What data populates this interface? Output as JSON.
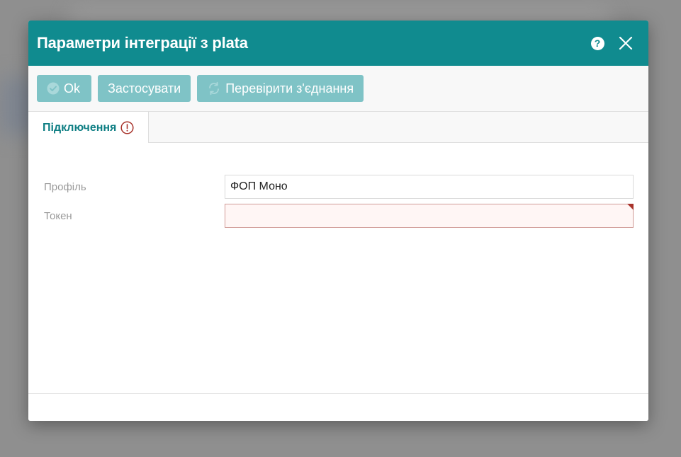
{
  "dialog": {
    "title": "Параметри інтеграції з plata",
    "help_icon": "help-circle-icon",
    "close_icon": "close-icon"
  },
  "toolbar": {
    "ok_label": "Ok",
    "apply_label": "Застосувати",
    "check_connection_label": "Перевірити з'єднання"
  },
  "tabs": [
    {
      "label": "Підключення",
      "active": true,
      "has_error": true
    }
  ],
  "form": {
    "profile": {
      "label": "Профіль",
      "value": "ФОП Моно"
    },
    "token": {
      "label": "Токен",
      "value": "",
      "invalid": true
    }
  },
  "colors": {
    "header": "#108b8f",
    "button": "#7fc3c6",
    "tab_text": "#0f7f84",
    "error": "#a8332b"
  }
}
